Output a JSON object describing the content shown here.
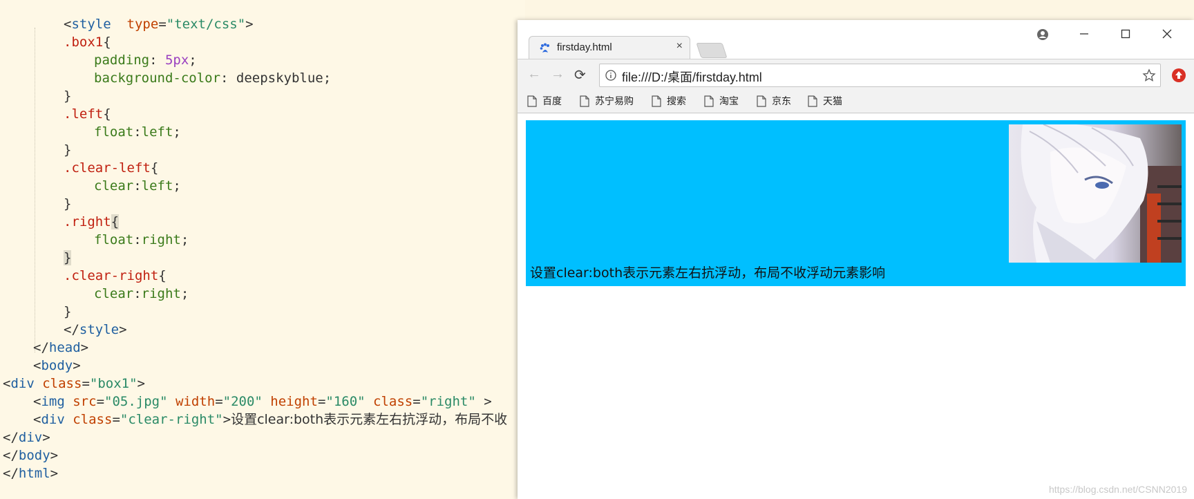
{
  "editor": {
    "lines": [
      {
        "parts": [
          [
            "punc",
            "<"
          ],
          [
            "tag",
            "style"
          ],
          [
            "punc",
            "  "
          ],
          [
            "attr",
            "type"
          ],
          [
            "punc",
            "="
          ],
          [
            "str",
            "\"text/css\""
          ],
          [
            "punc",
            ">"
          ]
        ]
      },
      {
        "parts": [
          [
            "sel",
            ".box1"
          ],
          [
            "punc",
            "{"
          ]
        ]
      },
      {
        "parts": [
          [
            "prop",
            "padding"
          ],
          [
            "punc",
            ": "
          ],
          [
            "num",
            "5px"
          ],
          [
            "punc",
            ";"
          ]
        ]
      },
      {
        "parts": [
          [
            "prop",
            "background-color"
          ],
          [
            "punc",
            ": deepskyblue;"
          ]
        ]
      },
      {
        "parts": [
          [
            "punc",
            "}"
          ]
        ]
      },
      {
        "parts": [
          [
            "sel",
            ".left"
          ],
          [
            "punc",
            "{"
          ]
        ]
      },
      {
        "parts": [
          [
            "prop",
            "float"
          ],
          [
            "punc",
            ":"
          ],
          [
            "prop",
            "left"
          ],
          [
            "punc",
            ";"
          ]
        ]
      },
      {
        "parts": [
          [
            "punc",
            "}"
          ]
        ]
      },
      {
        "parts": [
          [
            "sel",
            ".clear-left"
          ],
          [
            "punc",
            "{"
          ]
        ]
      },
      {
        "parts": [
          [
            "prop",
            "clear"
          ],
          [
            "punc",
            ":"
          ],
          [
            "prop",
            "left"
          ],
          [
            "punc",
            ";"
          ]
        ]
      },
      {
        "parts": [
          [
            "punc",
            "}"
          ]
        ]
      },
      {
        "parts": [
          [
            "sel",
            ".right"
          ],
          [
            "hl",
            "{"
          ]
        ]
      },
      {
        "parts": [
          [
            "prop",
            "float"
          ],
          [
            "punc",
            ":"
          ],
          [
            "prop",
            "right"
          ],
          [
            "punc",
            ";"
          ]
        ]
      },
      {
        "parts": [
          [
            "hl",
            "}"
          ]
        ]
      },
      {
        "parts": [
          [
            "sel",
            ".clear-right"
          ],
          [
            "punc",
            "{"
          ]
        ]
      },
      {
        "parts": [
          [
            "prop",
            "clear"
          ],
          [
            "punc",
            ":"
          ],
          [
            "prop",
            "right"
          ],
          [
            "punc",
            ";"
          ]
        ]
      },
      {
        "parts": [
          [
            "punc",
            "}"
          ]
        ]
      },
      {
        "parts": [
          [
            "punc",
            "</"
          ],
          [
            "tag",
            "style"
          ],
          [
            "punc",
            ">"
          ]
        ]
      },
      {
        "parts": [
          [
            "punc",
            "</"
          ],
          [
            "tag",
            "head"
          ],
          [
            "punc",
            ">"
          ]
        ]
      },
      {
        "parts": [
          [
            "punc",
            "<"
          ],
          [
            "tag",
            "body"
          ],
          [
            "punc",
            ">"
          ]
        ]
      },
      {
        "parts": [
          [
            "punc",
            "<"
          ],
          [
            "tag",
            "div"
          ],
          [
            "punc",
            " "
          ],
          [
            "attr",
            "class"
          ],
          [
            "punc",
            "="
          ],
          [
            "str",
            "\"box1\""
          ],
          [
            "punc",
            ">"
          ]
        ]
      },
      {
        "parts": [
          [
            "punc",
            "<"
          ],
          [
            "tag",
            "img"
          ],
          [
            "punc",
            " "
          ],
          [
            "attr",
            "src"
          ],
          [
            "punc",
            "="
          ],
          [
            "str",
            "\"05.jpg\""
          ],
          [
            "punc",
            " "
          ],
          [
            "attr",
            "width"
          ],
          [
            "punc",
            "="
          ],
          [
            "str",
            "\"200\""
          ],
          [
            "punc",
            " "
          ],
          [
            "attr",
            "height"
          ],
          [
            "punc",
            "="
          ],
          [
            "str",
            "\"160\""
          ],
          [
            "punc",
            " "
          ],
          [
            "attr",
            "class"
          ],
          [
            "punc",
            "="
          ],
          [
            "str",
            "\"right\""
          ],
          [
            "punc",
            " >"
          ]
        ]
      },
      {
        "parts": [
          [
            "punc",
            "<"
          ],
          [
            "tag",
            "div"
          ],
          [
            "punc",
            " "
          ],
          [
            "attr",
            "class"
          ],
          [
            "punc",
            "="
          ],
          [
            "str",
            "\"clear-right\""
          ],
          [
            "punc",
            ">"
          ],
          [
            "text",
            "设置clear:both表示元素左右抗浮动，布局不收"
          ]
        ]
      },
      {
        "parts": [
          [
            "punc",
            "</"
          ],
          [
            "tag",
            "div"
          ],
          [
            "punc",
            ">"
          ]
        ]
      },
      {
        "parts": [
          [
            "punc",
            "</"
          ],
          [
            "tag",
            "body"
          ],
          [
            "punc",
            ">"
          ]
        ]
      },
      {
        "parts": [
          [
            "punc",
            "</"
          ],
          [
            "tag",
            "html"
          ],
          [
            "punc",
            ">"
          ]
        ]
      }
    ]
  },
  "browser": {
    "tab": {
      "title": "firstday.html",
      "close": "×",
      "icon": "baidu-paw-icon"
    },
    "window_controls": {
      "account": "account-icon",
      "minimize": "—",
      "maximize": "☐",
      "close": "✕"
    },
    "nav": {
      "back": "←",
      "forward": "→",
      "reload": "⟳"
    },
    "address": {
      "url": "file:///D:/桌面/firstday.html",
      "info_icon": "info-icon",
      "star_icon": "star-icon"
    },
    "extension_icon": "upload-extension-icon",
    "bookmarks": [
      "百度",
      "苏宁易购",
      "搜索",
      "淘宝",
      "京东",
      "天猫"
    ],
    "page": {
      "box_text": "设置clear:both表示元素左右抗浮动，布局不收浮动元素影响",
      "box_color": "#00bfff",
      "image": "anime-character-image"
    },
    "watermark": "https://blog.csdn.net/CSNN2019"
  },
  "colors": {
    "editor_bg": "#fef8e6",
    "accent": "#00bfff"
  }
}
